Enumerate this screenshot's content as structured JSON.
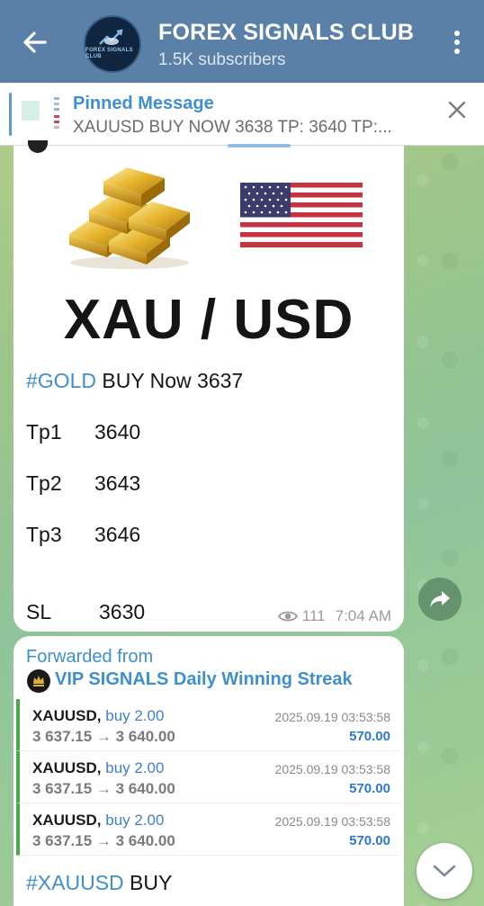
{
  "header": {
    "title": "FOREX SIGNALS CLUB",
    "subscribers": "1.5K subscribers",
    "avatar_text": "FOREX SIGNALS CLUB",
    "colors": {
      "bar": "#5b80a8"
    }
  },
  "pinned": {
    "title": "Pinned Message",
    "text": "XAUUSD BUY NOW 3638  TP: 3640 TP:..."
  },
  "message1": {
    "image_title": "XAU / USD",
    "hashtag": "#GOLD",
    "signal_text": " BUY Now 3637",
    "targets": [
      {
        "label": "Tp1",
        "value": "3640"
      },
      {
        "label": "Tp2",
        "value": "3643"
      },
      {
        "label": "Tp3",
        "value": "3646"
      }
    ],
    "stop_loss": {
      "label": "SL",
      "value": "3630"
    },
    "views": "111",
    "time": "7:04 AM"
  },
  "message2": {
    "forwarded_label": "Forwarded from",
    "source": "VIP SIGNALS Daily Winning Streak",
    "trades": [
      {
        "symbol": "XAUUSD,",
        "side": "buy 2.00",
        "prices": "3 637.15 → 3 640.00",
        "time": "2025.09.19 03:53:58",
        "profit": "570.00"
      },
      {
        "symbol": "XAUUSD,",
        "side": "buy 2.00",
        "prices": "3 637.15 → 3 640.00",
        "time": "2025.09.19 03:53:58",
        "profit": "570.00"
      },
      {
        "symbol": "XAUUSD,",
        "side": "buy 2.00",
        "prices": "3 637.15 → 3 640.00",
        "time": "2025.09.19 03:53:58",
        "profit": "570.00"
      }
    ],
    "hashtag": "#XAUUSD",
    "hashtag_rest": " BUY"
  },
  "icons": {
    "back": "arrow-left-icon",
    "menu": "more-vertical-icon",
    "close": "close-icon",
    "share": "share-arrow-icon",
    "views": "eye-icon",
    "scroll": "chevron-down-icon"
  }
}
